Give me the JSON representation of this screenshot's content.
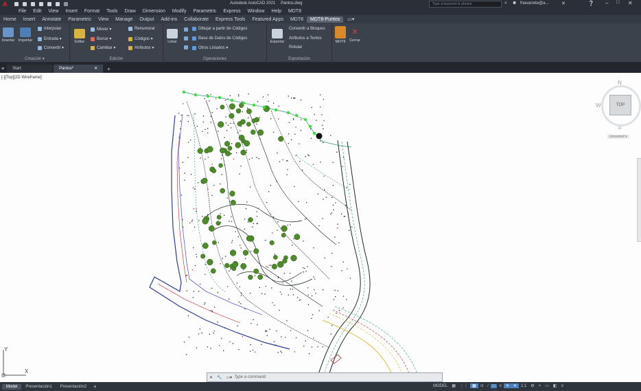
{
  "app": {
    "title": "Autodesk AutoCAD 2021",
    "filename": "Pantos.dwg",
    "search_placeholder": "Type a keyword or phrase",
    "user": "fnavarrete@a...",
    "logo_letter": "A"
  },
  "menu": [
    "File",
    "Edit",
    "View",
    "Insert",
    "Format",
    "Tools",
    "Draw",
    "Dimension",
    "Modify",
    "Parametric",
    "Express",
    "Window",
    "Help",
    "MDT8"
  ],
  "ribbon_tabs": [
    "Home",
    "Insert",
    "Annotate",
    "Parametric",
    "View",
    "Manage",
    "Output",
    "Add-ins",
    "Collaborate",
    "Express Tools",
    "Featured Apps",
    "MDT8",
    "MDT8-Puntos"
  ],
  "active_ribbon_tab": "MDT8-Puntos",
  "panels": {
    "creacion": {
      "title": "Creación ▾",
      "buttons": [
        "Insertar",
        "Importar"
      ],
      "rows": [
        "Interpolar",
        "Entrada ▾",
        "Convertir ▾"
      ]
    },
    "edicion": {
      "title": "Edición",
      "big": "Editar",
      "rows_a": [
        "Mover ▾",
        "Borrar ▾",
        "Cambiar ▾"
      ],
      "rows_b": [
        "Renumerar",
        "Códigos ▾",
        "Atributos ▾"
      ]
    },
    "operaciones": {
      "title": "Operaciones",
      "big": "Listar",
      "rows": [
        "Dibujar a partir de Códigos",
        "Base de Datos de Códigos",
        "Otros Listados ▾"
      ]
    },
    "exportacion": {
      "title": "Exportación",
      "big": "Exportar",
      "rows": [
        "Convertir a Bloques",
        "Atributos a Textos",
        "Rotular"
      ]
    },
    "extra": {
      "buttons": [
        "MDT8",
        "Cerrar"
      ]
    }
  },
  "doc_tabs": [
    "Start",
    "Pantos*"
  ],
  "viewport_label": "[-][Top][2D Wireframe]",
  "viewcube": {
    "north": "N",
    "south": "S",
    "west": "W",
    "top": "TOP",
    "wcs": "Unnamed ▾"
  },
  "ucs": {
    "x": "X",
    "y": "Y"
  },
  "command": {
    "placeholder": "Type a command"
  },
  "layout_tabs": [
    "Model",
    "Presentación1",
    "Presentación2"
  ],
  "status": {
    "space": "MODEL",
    "scale": "1:1"
  },
  "colors": {
    "green_point": "#3fdc3f",
    "tree": "#4f8b2b",
    "contour_dark": "#1e2a2a",
    "contour_green": "#2aa06a",
    "road_blue": "#2d3b92",
    "road_red": "#b52020",
    "contour_yellow": "#d8b020",
    "accent_tab": "#5b6572"
  }
}
